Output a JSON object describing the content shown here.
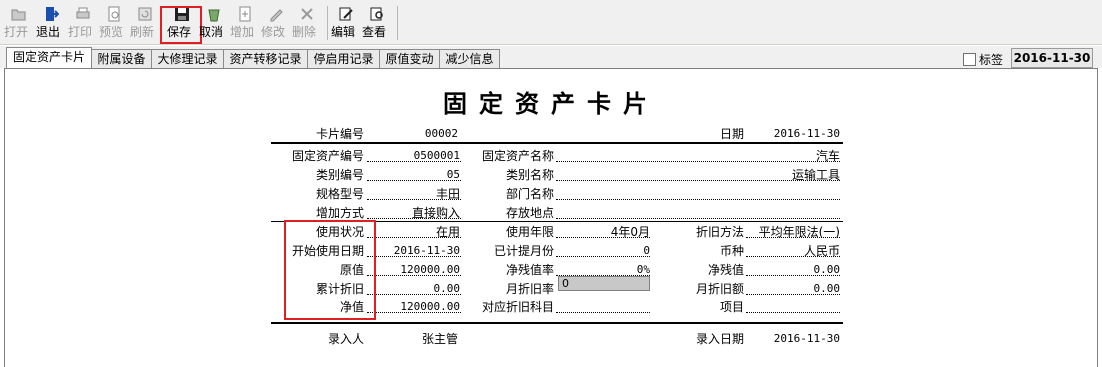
{
  "toolbar": {
    "open": "打开",
    "exit": "退出",
    "print": "打印",
    "preview": "预览",
    "refresh": "刷新",
    "save": "保存",
    "cancel": "取消",
    "add": "增加",
    "modify": "修改",
    "delete": "删除",
    "edit": "编辑",
    "view": "查看"
  },
  "tabs": [
    "固定资产卡片",
    "附属设备",
    "大修理记录",
    "资产转移记录",
    "停启用记录",
    "原值变动",
    "减少信息"
  ],
  "bookmark_label": "标签",
  "header_date": "2016-11-30",
  "card": {
    "title": "固定资产卡片",
    "card_no_label": "卡片编号",
    "card_no": "00002",
    "date_label": "日期",
    "date": "2016-11-30",
    "asset_no_label": "固定资产编号",
    "asset_no": "0500001",
    "asset_name_label": "固定资产名称",
    "asset_name": "汽车",
    "cat_no_label": "类别编号",
    "cat_no": "05",
    "cat_name_label": "类别名称",
    "cat_name": "运输工具",
    "model_label": "规格型号",
    "model": "丰田",
    "dept_label": "部门名称",
    "dept": "",
    "add_method_label": "增加方式",
    "add_method": "直接购入",
    "location_label": "存放地点",
    "location": "",
    "status_label": "使用状况",
    "status": "在用",
    "life_label": "使用年限",
    "life": "4年0月",
    "dep_method_label": "折旧方法",
    "dep_method": "平均年限法(一)",
    "start_date_label": "开始使用日期",
    "start_date": "2016-11-30",
    "months_label": "已计提月份",
    "months": "0",
    "currency_label": "币种",
    "currency": "人民币",
    "orig_value_label": "原值",
    "orig_value": "120000.00",
    "salvage_rate_label": "净残值率",
    "salvage_rate": "0%",
    "salvage_label": "净残值",
    "salvage": "0.00",
    "acc_dep_label": "累计折旧",
    "acc_dep": "0.00",
    "monthly_rate_label": "月折旧率",
    "monthly_rate": "0",
    "monthly_dep_label": "月折旧额",
    "monthly_dep": "0.00",
    "net_value_label": "净值",
    "net_value": "120000.00",
    "dep_account_label": "对应折旧科目",
    "dep_account": "",
    "project_label": "项目",
    "project": "",
    "entered_by_label": "录入人",
    "entered_by": "张主管",
    "entry_date_label": "录入日期",
    "entry_date": "2016-11-30"
  }
}
